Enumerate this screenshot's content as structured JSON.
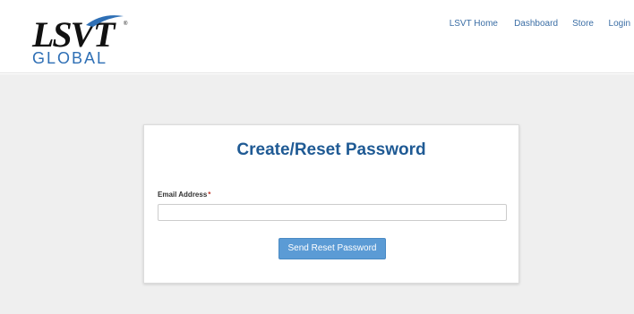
{
  "header": {
    "logo": {
      "text": "LSVT",
      "subtext": "GLOBAL",
      "trademark": "®",
      "icon": "lsvt-global-logo"
    },
    "nav": [
      {
        "label": "LSVT Home"
      },
      {
        "label": "Dashboard"
      },
      {
        "label": "Store"
      },
      {
        "label": "Login"
      }
    ]
  },
  "form": {
    "title": "Create/Reset Password",
    "email_label": "Email Address",
    "required_mark": "*",
    "email_value": "",
    "email_placeholder": "",
    "submit_label": "Send Reset Password"
  },
  "colors": {
    "title_blue": "#1f5a94",
    "button_blue": "#5b9bd5",
    "nav_link": "#3b6ea5",
    "page_bg": "#efefef",
    "required_red": "#c0392b"
  }
}
